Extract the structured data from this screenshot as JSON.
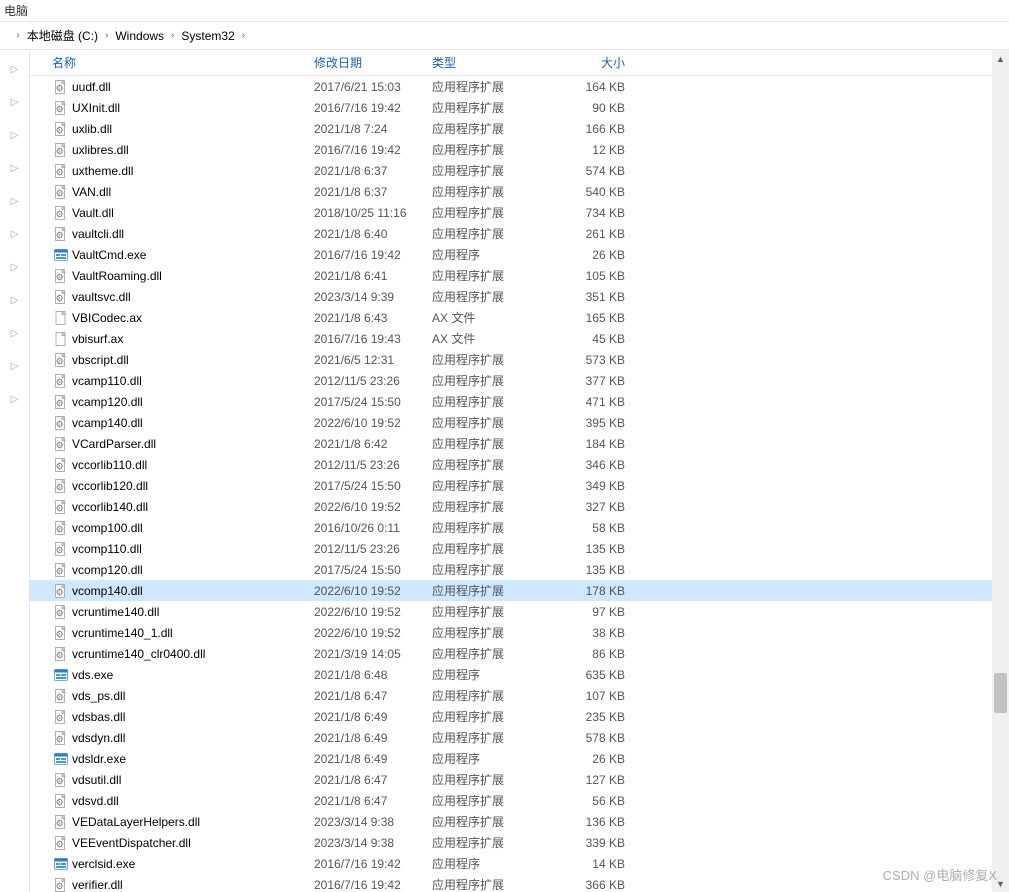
{
  "topbar": {
    "label": "电脑"
  },
  "breadcrumb": {
    "items": [
      {
        "label": "本地磁盘 (C:)"
      },
      {
        "label": "Windows"
      },
      {
        "label": "System32"
      }
    ]
  },
  "columns": {
    "name": "名称",
    "date": "修改日期",
    "type": "类型",
    "size": "大小"
  },
  "files": [
    {
      "icon": "dll",
      "name": "uudf.dll",
      "date": "2017/6/21 15:03",
      "type": "应用程序扩展",
      "size": "164 KB",
      "selected": false
    },
    {
      "icon": "dll",
      "name": "UXInit.dll",
      "date": "2016/7/16 19:42",
      "type": "应用程序扩展",
      "size": "90 KB",
      "selected": false
    },
    {
      "icon": "dll",
      "name": "uxlib.dll",
      "date": "2021/1/8 7:24",
      "type": "应用程序扩展",
      "size": "166 KB",
      "selected": false
    },
    {
      "icon": "dll",
      "name": "uxlibres.dll",
      "date": "2016/7/16 19:42",
      "type": "应用程序扩展",
      "size": "12 KB",
      "selected": false
    },
    {
      "icon": "dll",
      "name": "uxtheme.dll",
      "date": "2021/1/8 6:37",
      "type": "应用程序扩展",
      "size": "574 KB",
      "selected": false
    },
    {
      "icon": "dll",
      "name": "VAN.dll",
      "date": "2021/1/8 6:37",
      "type": "应用程序扩展",
      "size": "540 KB",
      "selected": false
    },
    {
      "icon": "dll",
      "name": "Vault.dll",
      "date": "2018/10/25 11:16",
      "type": "应用程序扩展",
      "size": "734 KB",
      "selected": false
    },
    {
      "icon": "dll",
      "name": "vaultcli.dll",
      "date": "2021/1/8 6:40",
      "type": "应用程序扩展",
      "size": "261 KB",
      "selected": false
    },
    {
      "icon": "exe",
      "name": "VaultCmd.exe",
      "date": "2016/7/16 19:42",
      "type": "应用程序",
      "size": "26 KB",
      "selected": false
    },
    {
      "icon": "dll",
      "name": "VaultRoaming.dll",
      "date": "2021/1/8 6:41",
      "type": "应用程序扩展",
      "size": "105 KB",
      "selected": false
    },
    {
      "icon": "dll",
      "name": "vaultsvc.dll",
      "date": "2023/3/14 9:39",
      "type": "应用程序扩展",
      "size": "351 KB",
      "selected": false
    },
    {
      "icon": "file",
      "name": "VBICodec.ax",
      "date": "2021/1/8 6:43",
      "type": "AX 文件",
      "size": "165 KB",
      "selected": false
    },
    {
      "icon": "file",
      "name": "vbisurf.ax",
      "date": "2016/7/16 19:43",
      "type": "AX 文件",
      "size": "45 KB",
      "selected": false
    },
    {
      "icon": "dll",
      "name": "vbscript.dll",
      "date": "2021/6/5 12:31",
      "type": "应用程序扩展",
      "size": "573 KB",
      "selected": false
    },
    {
      "icon": "dll",
      "name": "vcamp110.dll",
      "date": "2012/11/5 23:26",
      "type": "应用程序扩展",
      "size": "377 KB",
      "selected": false
    },
    {
      "icon": "dll",
      "name": "vcamp120.dll",
      "date": "2017/5/24 15:50",
      "type": "应用程序扩展",
      "size": "471 KB",
      "selected": false
    },
    {
      "icon": "dll",
      "name": "vcamp140.dll",
      "date": "2022/6/10 19:52",
      "type": "应用程序扩展",
      "size": "395 KB",
      "selected": false
    },
    {
      "icon": "dll",
      "name": "VCardParser.dll",
      "date": "2021/1/8 6:42",
      "type": "应用程序扩展",
      "size": "184 KB",
      "selected": false
    },
    {
      "icon": "dll",
      "name": "vccorlib110.dll",
      "date": "2012/11/5 23:26",
      "type": "应用程序扩展",
      "size": "346 KB",
      "selected": false
    },
    {
      "icon": "dll",
      "name": "vccorlib120.dll",
      "date": "2017/5/24 15:50",
      "type": "应用程序扩展",
      "size": "349 KB",
      "selected": false
    },
    {
      "icon": "dll",
      "name": "vccorlib140.dll",
      "date": "2022/6/10 19:52",
      "type": "应用程序扩展",
      "size": "327 KB",
      "selected": false
    },
    {
      "icon": "dll",
      "name": "vcomp100.dll",
      "date": "2016/10/26 0:11",
      "type": "应用程序扩展",
      "size": "58 KB",
      "selected": false
    },
    {
      "icon": "dll",
      "name": "vcomp110.dll",
      "date": "2012/11/5 23:26",
      "type": "应用程序扩展",
      "size": "135 KB",
      "selected": false
    },
    {
      "icon": "dll",
      "name": "vcomp120.dll",
      "date": "2017/5/24 15:50",
      "type": "应用程序扩展",
      "size": "135 KB",
      "selected": false
    },
    {
      "icon": "dll",
      "name": "vcomp140.dll",
      "date": "2022/6/10 19:52",
      "type": "应用程序扩展",
      "size": "178 KB",
      "selected": true
    },
    {
      "icon": "dll",
      "name": "vcruntime140.dll",
      "date": "2022/6/10 19:52",
      "type": "应用程序扩展",
      "size": "97 KB",
      "selected": false
    },
    {
      "icon": "dll",
      "name": "vcruntime140_1.dll",
      "date": "2022/6/10 19:52",
      "type": "应用程序扩展",
      "size": "38 KB",
      "selected": false
    },
    {
      "icon": "dll",
      "name": "vcruntime140_clr0400.dll",
      "date": "2021/3/19 14:05",
      "type": "应用程序扩展",
      "size": "86 KB",
      "selected": false
    },
    {
      "icon": "exe",
      "name": "vds.exe",
      "date": "2021/1/8 6:48",
      "type": "应用程序",
      "size": "635 KB",
      "selected": false
    },
    {
      "icon": "dll",
      "name": "vds_ps.dll",
      "date": "2021/1/8 6:47",
      "type": "应用程序扩展",
      "size": "107 KB",
      "selected": false
    },
    {
      "icon": "dll",
      "name": "vdsbas.dll",
      "date": "2021/1/8 6:49",
      "type": "应用程序扩展",
      "size": "235 KB",
      "selected": false
    },
    {
      "icon": "dll",
      "name": "vdsdyn.dll",
      "date": "2021/1/8 6:49",
      "type": "应用程序扩展",
      "size": "578 KB",
      "selected": false
    },
    {
      "icon": "exe",
      "name": "vdsldr.exe",
      "date": "2021/1/8 6:49",
      "type": "应用程序",
      "size": "26 KB",
      "selected": false
    },
    {
      "icon": "dll",
      "name": "vdsutil.dll",
      "date": "2021/1/8 6:47",
      "type": "应用程序扩展",
      "size": "127 KB",
      "selected": false
    },
    {
      "icon": "dll",
      "name": "vdsvd.dll",
      "date": "2021/1/8 6:47",
      "type": "应用程序扩展",
      "size": "56 KB",
      "selected": false
    },
    {
      "icon": "dll",
      "name": "VEDataLayerHelpers.dll",
      "date": "2023/3/14 9:38",
      "type": "应用程序扩展",
      "size": "136 KB",
      "selected": false
    },
    {
      "icon": "dll",
      "name": "VEEventDispatcher.dll",
      "date": "2023/3/14 9:38",
      "type": "应用程序扩展",
      "size": "339 KB",
      "selected": false
    },
    {
      "icon": "exe",
      "name": "verclsid.exe",
      "date": "2016/7/16 19:42",
      "type": "应用程序",
      "size": "14 KB",
      "selected": false
    },
    {
      "icon": "dll",
      "name": "verifier.dll",
      "date": "2016/7/16 19:42",
      "type": "应用程序扩展",
      "size": "366 KB",
      "selected": false
    }
  ],
  "watermark": "CSDN @电脑修复X"
}
